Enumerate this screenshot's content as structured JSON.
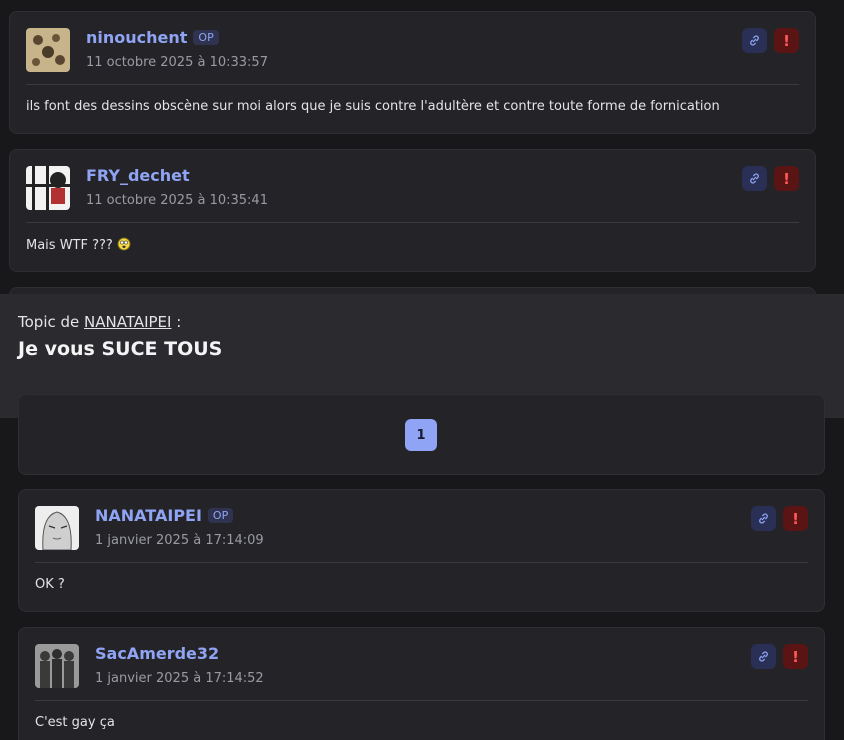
{
  "posts_top": [
    {
      "author": "ninouchent",
      "badge": "OP",
      "date": "11 octobre 2025 à 10:33:57",
      "content": "ils font des dessins obscène sur moi alors que je suis contre l'adultère et contre toute forme de fornication"
    },
    {
      "author": "FRY_dechet",
      "date": "11 octobre 2025 à 10:35:41",
      "content": "Mais WTF ???"
    }
  ],
  "topic": {
    "prefix": "Topic de",
    "author": "NANATAIPEI",
    "suffix": " :",
    "title": "Je vous SUCE TOUS"
  },
  "pagination": {
    "current_page": "1"
  },
  "posts_bottom": [
    {
      "author": "NANATAIPEI",
      "badge": "OP",
      "date": "1 janvier 2025 à 17:14:09",
      "content": "OK ?"
    },
    {
      "author": "SacAmerde32",
      "date": "1 janvier 2025 à 17:14:52",
      "content": "C'est gay ça"
    }
  ],
  "colors": {
    "background": "#18181b",
    "card": "#242428",
    "accent": "#8fa4f4",
    "report": "#5a1414"
  },
  "icons": {
    "permalink": "link-icon",
    "report": "exclamation-icon"
  }
}
